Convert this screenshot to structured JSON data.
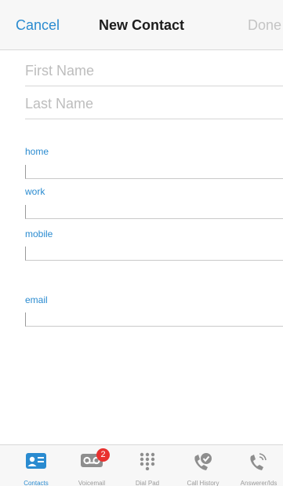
{
  "navbar": {
    "cancel_label": "Cancel",
    "title": "New Contact",
    "done_label": "Done"
  },
  "form": {
    "first_name_placeholder": "First Name",
    "last_name_placeholder": "Last Name",
    "fields": [
      {
        "label": "home",
        "value": ""
      },
      {
        "label": "work",
        "value": ""
      },
      {
        "label": "mobile",
        "value": ""
      },
      {
        "label": "email",
        "value": ""
      }
    ]
  },
  "tabbar": {
    "tabs": [
      {
        "label": "Contacts",
        "icon": "contacts-icon",
        "active": true
      },
      {
        "label": "Voicemail",
        "icon": "voicemail-icon",
        "badge": "2"
      },
      {
        "label": "Dial Pad",
        "icon": "dialpad-icon"
      },
      {
        "label": "Call History",
        "icon": "call-history-icon"
      },
      {
        "label": "Answerer/Ids",
        "icon": "answerer-icon"
      }
    ]
  },
  "colors": {
    "accent": "#2a8bd0",
    "badge": "#e8312f",
    "placeholder": "#bdbdbd"
  }
}
